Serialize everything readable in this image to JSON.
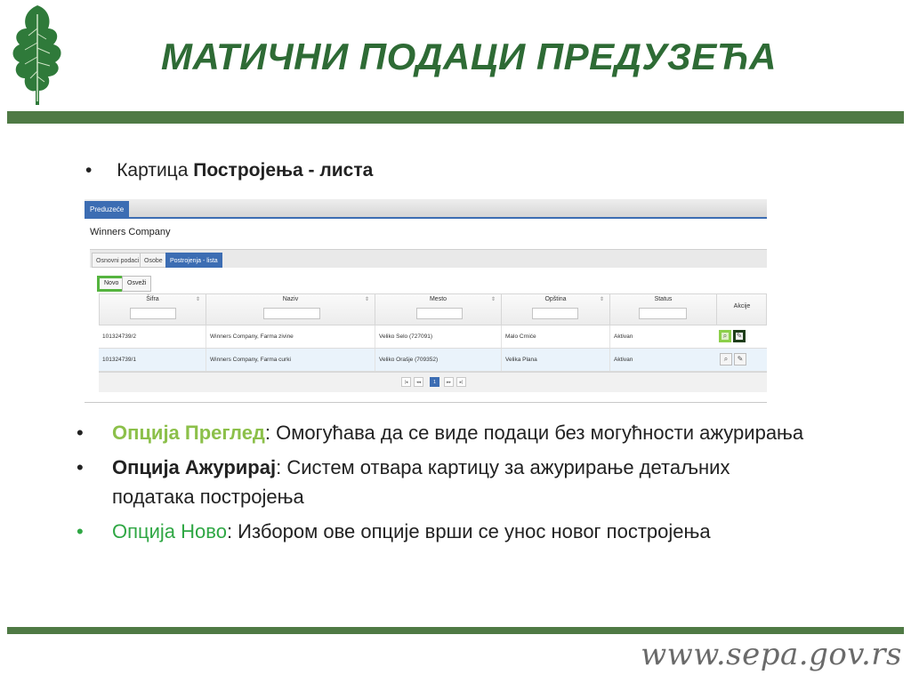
{
  "slide": {
    "title": "МАТИЧНИ ПОДАЦИ ПРЕДУЗЕЋА",
    "url": "www.sepa.gov.rs",
    "top_bullet": {
      "dot": "•",
      "prefix": "Картица",
      "bold": "Постројења - листа"
    }
  },
  "app": {
    "main_tab": "Preduzeće",
    "company_name": "Winners Company",
    "subtabs": [
      "Osnovni podaci",
      "Osobe",
      "Postrojenja - lista"
    ],
    "active_subtab": 2,
    "buttons": {
      "new": "Novo",
      "refresh": "Osveži"
    },
    "columns": [
      "Šifra",
      "Naziv",
      "Mesto",
      "Opština",
      "Status",
      "Akcije"
    ],
    "sort_glyph": "⇕",
    "rows": [
      {
        "sifra": "101324739/2",
        "naziv": "Winners Company, Farma zivine",
        "mesto": "Veliko Selo (727091)",
        "opstina": "Malo Crniće",
        "status": "Aktivan"
      },
      {
        "sifra": "101324739/1",
        "naziv": "Winners Company, Farma curki",
        "mesto": "Veliko Orašje (709352)",
        "opstina": "Velika Plana",
        "status": "Aktivan"
      }
    ],
    "icons": {
      "view": "magnifier-icon",
      "edit": "pencil-icon"
    },
    "pager": {
      "first": "|◂",
      "prev": "◂◂",
      "current": "1",
      "next": "▸▸",
      "last": "▸|"
    }
  },
  "bullets": [
    {
      "dot": "•",
      "label": "Опција Преглед",
      "rest": ": Омогућава да се виде подаци без могућности ажурирања"
    },
    {
      "dot": "•",
      "label": "Опција Ажурирај",
      "rest": ": Систем отвара картицу за ажурирање детаљних података постројења"
    },
    {
      "dot": "•",
      "label": "Опција Ново",
      "rest": ": Избором ове опције врши се унос новог постројења"
    }
  ],
  "colors": {
    "brand_green": "#2e6b35",
    "band_green": "#4f7a45",
    "app_blue": "#3c6db3",
    "highlight_light_green": "#8cc04a",
    "highlight_green": "#2fa744"
  }
}
